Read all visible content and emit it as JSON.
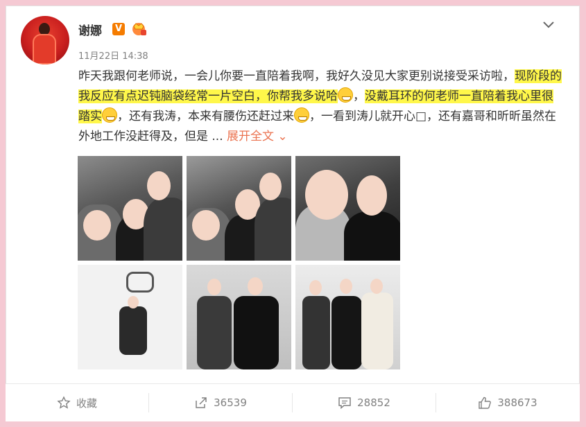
{
  "post": {
    "username": "谢娜",
    "badge_v": "V",
    "timestamp": "11月22日 14:38",
    "text_before": "昨天我跟何老师说，一会儿你要一直陪着我啊，我好久没见大家更别说接受采访啦，",
    "text_hl1": "现阶段的我反应有点迟钝脑袋经常一片空白，你帮我多说哈",
    "text_between": "，",
    "text_hl2": "没戴耳环的何老师一直陪着我心里很踏实",
    "text_after": "，还有我涛，本来有腰伤还赶过来",
    "text_tail": "，一看到涛儿就开心□，还有嘉哥和昕昕虽然在外地工作没赶得及，但是 ... ",
    "expand_label": "展开全文"
  },
  "toolbar": {
    "favorite_label": "收藏",
    "share_count": "36539",
    "comment_count": "28852",
    "like_count": "388673"
  },
  "colors": {
    "background": "#f5c9d3",
    "highlight": "#fff74a",
    "link": "#eb7350",
    "badge": "#f57c00"
  },
  "icons": [
    "chevron-down-icon",
    "star-icon",
    "share-icon",
    "comment-icon",
    "thumbs-up-icon",
    "vip-crown-icon"
  ]
}
